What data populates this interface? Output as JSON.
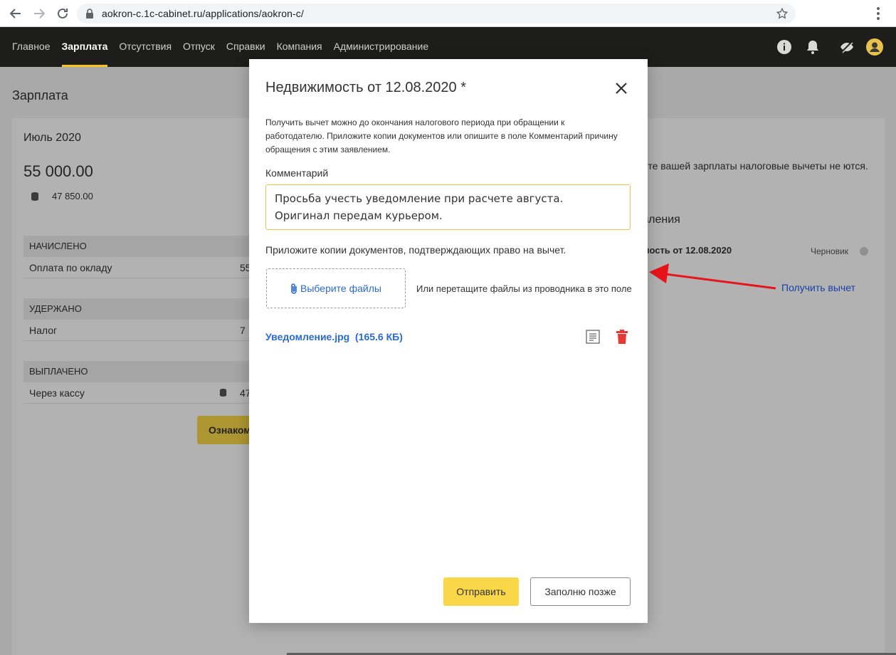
{
  "browser": {
    "url": "aokron-c.1c-cabinet.ru/applications/aokron-c/"
  },
  "nav": {
    "items": [
      {
        "label": "Главное"
      },
      {
        "label": "Зарплата",
        "active": true
      },
      {
        "label": "Отсутствия"
      },
      {
        "label": "Отпуск"
      },
      {
        "label": "Справки"
      },
      {
        "label": "Компания"
      },
      {
        "label": "Администрирование"
      }
    ]
  },
  "page": {
    "title": "Зарплата",
    "month": "Июль 2020",
    "amount": "55 000.00",
    "cash_amount": "47 850.00",
    "sections": {
      "accrued": {
        "title": "НАЧИСЛЕНО",
        "row_label": "Оплата по окладу",
        "row_value": "55"
      },
      "withheld": {
        "title": "УДЕРЖАНО",
        "row_label": "Налог",
        "row_value": "7"
      },
      "paid": {
        "title": "ВЫПЛАЧЕНО",
        "row_label": "Через кассу",
        "row_value": "47"
      }
    },
    "view_button": "Ознаком",
    "right_text": "ете вашей зарплаты налоговые вычеты не ются.",
    "right_head": "вления",
    "right_item": "мость от 12.08.2020",
    "right_status": "Черновик"
  },
  "annotation": {
    "text": "Получить вычет",
    "color": "#e8141b"
  },
  "modal": {
    "title": "Недвижимость от 12.08.2020 *",
    "info": "Получить вычет можно до окончания налогового периода при обращении к работодателю. Приложите копии документов или опишите в поле Комментарий причину обращения с этим заявлением.",
    "comment_label": "Комментарий",
    "comment_value": "Просьба учесть уведомление при расчете августа. Оригинал передам курьером.",
    "attach_hint": "Приложите копии документов, подтверждающих право на вычет.",
    "choose_files": "Выберите файлы",
    "drop_hint": "Или перетащите файлы из проводника в это поле",
    "file_name": "Уведомление.jpg",
    "file_size": "(165.6 КБ)",
    "send_label": "Отправить",
    "later_label": "Заполню позже"
  },
  "colors": {
    "accent": "#f9d748",
    "header_bg": "#1d1d1b",
    "link": "#2a6ad1"
  }
}
